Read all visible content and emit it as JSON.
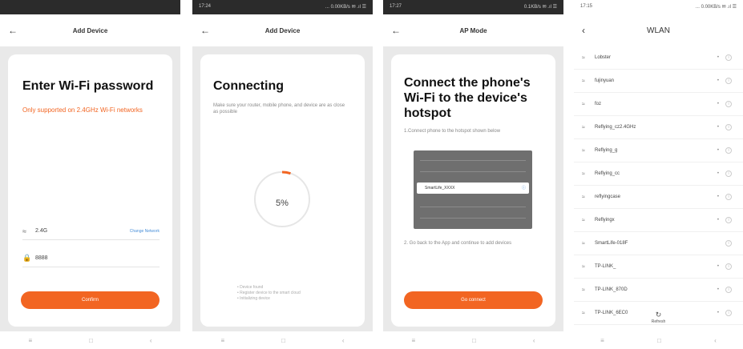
{
  "panel1": {
    "status": {
      "time": "",
      "right": ""
    },
    "title": "Add Device",
    "heading": "Enter Wi-Fi password",
    "note": "Only supported on 2.4GHz Wi-Fi networks",
    "wifi_value": "2.4G",
    "change_network": "Change Network",
    "password_value": "8888",
    "confirm": "Confirm"
  },
  "panel2": {
    "status": {
      "time": "17:24",
      "right": "... 0.00KB/s ✉ .ıl ☰"
    },
    "title": "Add Device",
    "heading": "Connecting",
    "desc": "Make sure your router, mobile phone, and device are as close as possible",
    "percent": "5%",
    "progress": 0.05,
    "steps": [
      "Device found",
      "Register device to the smart cloud",
      "Initializing device"
    ]
  },
  "panel3": {
    "status": {
      "time": "17:27",
      "right": "0.1KB/s ✉ .ıl ☰"
    },
    "title": "AP Mode",
    "heading": "Connect the phone's Wi-Fi to the device's hotspot",
    "step1": "1.Connect phone to the hotspot shown below",
    "hotspot": "SmartLife_XXXX",
    "step2": "2. Go back to the App and continue to add devices",
    "go_connect": "Go connect"
  },
  "panel4": {
    "status": {
      "time": "17:15",
      "right": "... 0.00KB/s ✉ .ıl ☰"
    },
    "title": "WLAN",
    "networks": [
      {
        "name": "Lobster",
        "locked": true
      },
      {
        "name": "fujinyuan",
        "locked": true
      },
      {
        "name": "foz",
        "locked": true
      },
      {
        "name": "Reflying_cz2.4GHz",
        "locked": true
      },
      {
        "name": "Reflying_g",
        "locked": true
      },
      {
        "name": "Reflying_cc",
        "locked": true
      },
      {
        "name": "reflyingcase",
        "locked": true
      },
      {
        "name": "Reflyingx",
        "locked": true
      },
      {
        "name": "SmartLife-018F",
        "locked": false
      },
      {
        "name": "TP-LINK_",
        "locked": true
      },
      {
        "name": "TP-LINK_870D",
        "locked": true
      },
      {
        "name": "TP-LINK_6EC0",
        "locked": true
      }
    ],
    "refresh": "Refresh"
  },
  "nav": {
    "recent": "≡",
    "home": "□",
    "back": "‹"
  }
}
